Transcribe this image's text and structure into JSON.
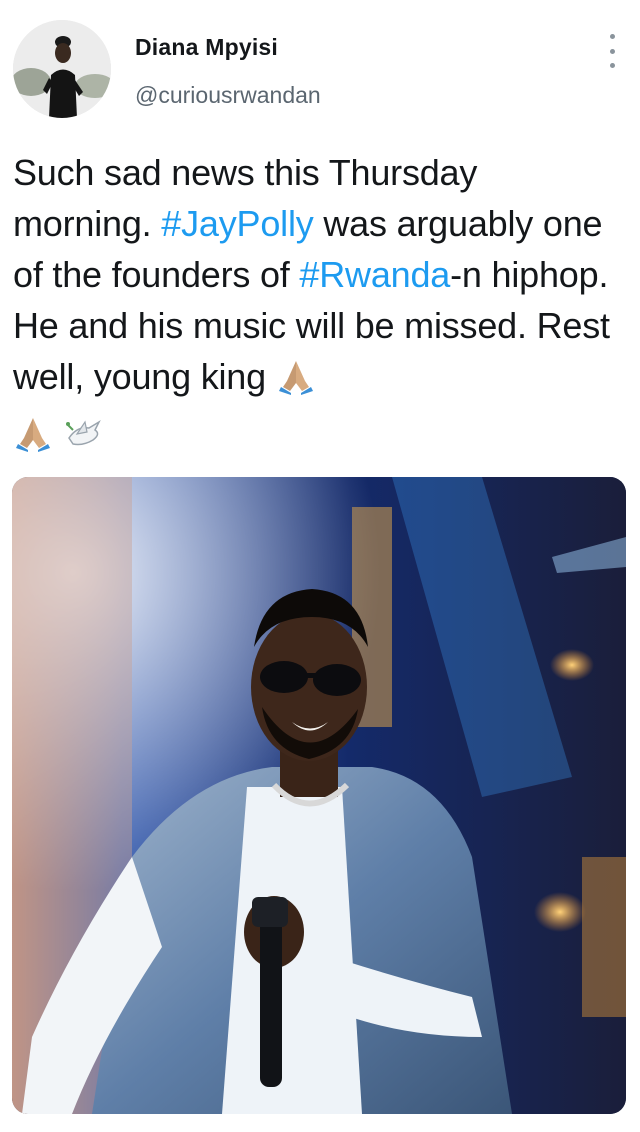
{
  "author": {
    "display_name": "Diana Mpyisi",
    "handle": "@curiousrwandan"
  },
  "tweet": {
    "text_part1": "Such sad news this Thursday morning. ",
    "hashtag1": "#JayPolly",
    "text_part2": " was arguably one of the founders of ",
    "hashtag2": "#Rwanda",
    "text_part3": "-n hiphop. He and his music will be missed. Rest well,  young king ",
    "emojis": [
      "folded-hands",
      "folded-hands",
      "dove"
    ]
  },
  "colors": {
    "hashtag": "#1d9bf0",
    "handle": "#5b6670",
    "text": "#14171a"
  },
  "icons": {
    "more": "vertical-ellipsis-icon"
  }
}
